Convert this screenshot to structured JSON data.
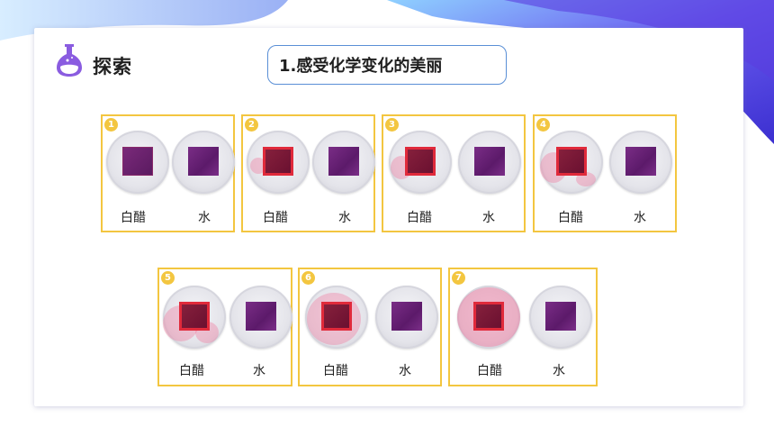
{
  "header": {
    "title": "探索",
    "subtitle": "1.感受化学变化的美丽"
  },
  "panels": [
    {
      "num": "1",
      "left_label": "白醋",
      "right_label": "水"
    },
    {
      "num": "2",
      "left_label": "白醋",
      "right_label": "水"
    },
    {
      "num": "3",
      "left_label": "白醋",
      "right_label": "水"
    },
    {
      "num": "4",
      "left_label": "白醋",
      "right_label": "水"
    },
    {
      "num": "5",
      "left_label": "白醋",
      "right_label": "水"
    },
    {
      "num": "6",
      "left_label": "白醋",
      "right_label": "水"
    },
    {
      "num": "7",
      "left_label": "白醋",
      "right_label": "水"
    }
  ],
  "colors": {
    "accent": "#f3c640",
    "pill_border": "#5a8fd6",
    "icon": "#7b4fd6"
  },
  "icons": {
    "flask": "flask-icon"
  }
}
